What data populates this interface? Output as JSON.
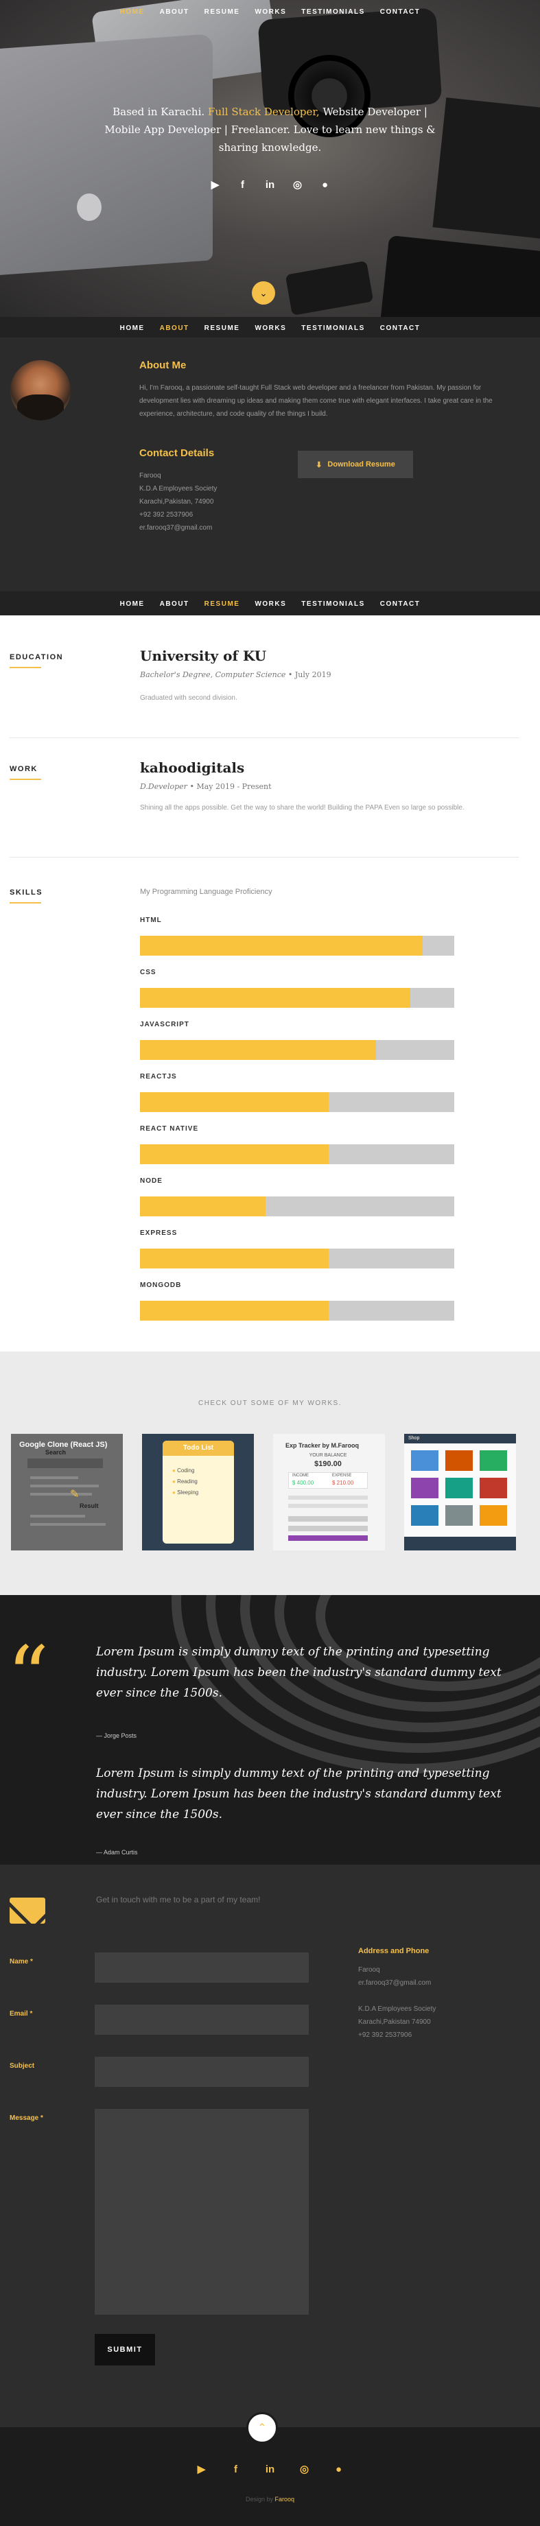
{
  "nav": [
    "HOME",
    "ABOUT",
    "RESUME",
    "WORKS",
    "TESTIMONIALS",
    "CONTACT"
  ],
  "hero": {
    "tagline_pre": "Based in Karachi. ",
    "tagline_hl": "Full Stack Developer,",
    "tagline_post": " Website Developer | Mobile App Developer | Freelancer. Love to learn new things & sharing knowledge.",
    "social_icons": [
      "youtube-icon",
      "facebook-icon",
      "linkedin-icon",
      "instagram-icon",
      "github-icon"
    ]
  },
  "about": {
    "title": "About Me",
    "bio": "Hi, I'm Farooq, a passionate self-taught Full Stack web developer and a freelancer from Pakistan. My passion for development lies with dreaming up ideas and making them come true with elegant interfaces. I take great care in the experience, architecture, and code quality of the things I build.",
    "contact_title": "Contact Details",
    "contact_lines": [
      "Farooq",
      "K.D.A Employees Society",
      "Karachi,Pakistan, 74900",
      "+92 392 2537906",
      "er.farooq37@gmail.com"
    ],
    "download_label": "Download Resume"
  },
  "resume": {
    "education": {
      "label": "EDUCATION",
      "school": "University of KU",
      "degree": "Bachelor's Degree, Computer Science",
      "date": "July 2019",
      "desc": "Graduated with second division."
    },
    "work": {
      "label": "WORK",
      "company": "kahoodigitals",
      "role": "D.Developer",
      "date": "May 2019 - Present",
      "desc": "Shining all the apps possible. Get the way to share the world! Building the PAPA Even so large so possible."
    },
    "skills": {
      "label": "SKILLS",
      "header": "My Programming Language Proficiency",
      "items": [
        {
          "name": "HTML",
          "level": 0.9
        },
        {
          "name": "CSS",
          "level": 0.86
        },
        {
          "name": "JAVASCRIPT",
          "level": 0.75
        },
        {
          "name": "REACTJS",
          "level": 0.6
        },
        {
          "name": "REACT NATIVE",
          "level": 0.6
        },
        {
          "name": "NODE",
          "level": 0.4
        },
        {
          "name": "EXPRESS",
          "level": 0.6
        },
        {
          "name": "MONGODB",
          "level": 0.6
        }
      ]
    }
  },
  "works": {
    "header": "CHECK OUT SOME OF MY WORKS.",
    "tiles": [
      {
        "title": "Google Clone (React JS)",
        "caption": "Search",
        "result": "Result"
      },
      {
        "title": "Todo List",
        "items": [
          "Coding",
          "Reading",
          "Sleeping"
        ]
      },
      {
        "title": "Exp Tracker by M.Farooq",
        "amounts": [
          "YOUR BALANCE",
          "$190.00",
          "INCOME",
          "$ 400.00",
          "EXPENSE",
          "$ 210.00"
        ]
      },
      {
        "title": "Shop"
      }
    ]
  },
  "testimonials": [
    {
      "text": "Lorem Ipsum is simply dummy text of the printing and typesetting industry. Lorem Ipsum has been the industry's standard dummy text ever since the 1500s.",
      "author": "— Jorge Posts"
    },
    {
      "text": "Lorem Ipsum is simply dummy text of the printing and typesetting industry. Lorem Ipsum has been the industry's standard dummy text ever since the 1500s.",
      "author": "— Adam Curtis"
    }
  ],
  "contact": {
    "intro": "Get in touch with me to be a part of my team!",
    "name_label": "Name *",
    "email_label": "Email *",
    "subject_label": "Subject",
    "message_label": "Message *",
    "submit_label": "SUBMIT",
    "side_title": "Address and Phone",
    "side_lines": [
      "Farooq",
      "er.farooq37@gmail.com",
      "",
      "K.D.A Employees Society",
      "Karachi,Pakistan 74900",
      "+92 392 2537906"
    ]
  },
  "footer": {
    "credit_pre": "Design by ",
    "credit_name": "Farooq",
    "social_icons": [
      "youtube-icon",
      "facebook-icon",
      "linkedin-icon",
      "instagram-icon",
      "github-icon"
    ]
  },
  "colors": {
    "accent": "#f5c04a",
    "bar": "#f9c33d",
    "dark": "#2b2b2b"
  }
}
